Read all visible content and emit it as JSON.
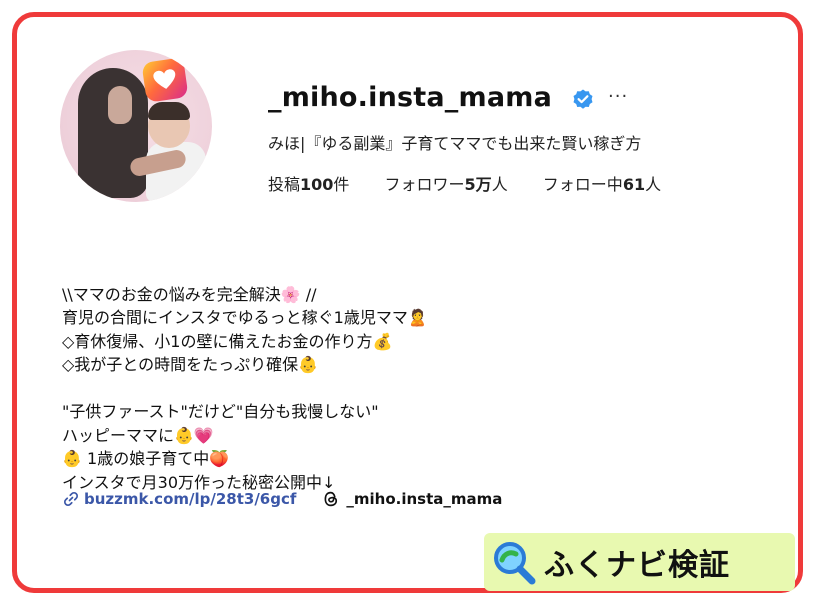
{
  "profile": {
    "username": "_miho.insta_mama",
    "full_name": "みほ|『ゆる副業』子育てママでも出来た賢い稼ぎ方",
    "more_label": "···",
    "stats": {
      "posts_label": "投稿",
      "posts_value": "100",
      "posts_unit": "件",
      "followers_label": "フォロワー",
      "followers_value": "5万",
      "followers_unit": "人",
      "following_label": "フォロー中",
      "following_value": "61",
      "following_unit": "人"
    },
    "bio_lines": [
      "\\\\ママのお金の悩みを完全解決🌸 //",
      "育児の合間にインスタでゆるっと稼ぐ1歳児ママ🙎",
      "◇育休復帰、小1の壁に備えたお金の作り方💰",
      "◇我が子との時間をたっぷり確保👶",
      "",
      "\"子供ファースト\"だけど\"自分も我慢しない\"",
      "ハッピーママに👶💗",
      "👶 1歳の娘子育て中🍑",
      "インスタで月30万作った秘密公開中↓"
    ],
    "link_url": "buzzmk.com/lp/28t3/6gcf",
    "threads_handle": "_miho.insta_mama"
  },
  "watermark": {
    "text": "ふくナビ検証"
  },
  "colors": {
    "frame": "#ef3a3a",
    "verified": "#3897f0",
    "link": "#3b57a8",
    "watermark_bg": "#e8f9b0"
  },
  "icons": {
    "verified": "verified-badge-icon",
    "link": "link-icon",
    "threads": "threads-icon",
    "search": "magnifier-icon"
  }
}
